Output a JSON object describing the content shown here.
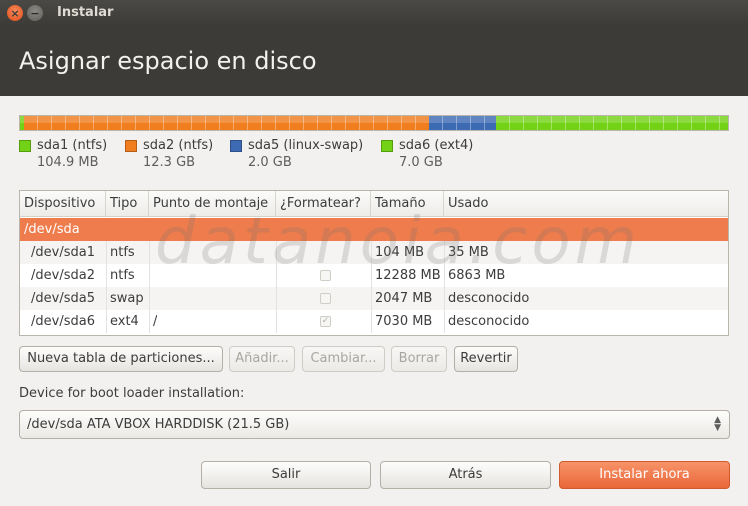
{
  "window": {
    "title": "Instalar",
    "close_glyph": "×",
    "minimize_glyph": "−"
  },
  "page": {
    "title": "Asignar espacio en disco"
  },
  "partition_bar": [
    {
      "name": "sda1",
      "share": 0.005,
      "color": "#73d216"
    },
    {
      "name": "sda2",
      "share": 0.573,
      "color": "#f07d1e"
    },
    {
      "name": "sda5",
      "share": 0.095,
      "color": "#3d6bb3"
    },
    {
      "name": "sda6",
      "share": 0.327,
      "color": "#73d216"
    }
  ],
  "legend": [
    {
      "name": "sda1 (ntfs)",
      "size": "104.9 MB",
      "color": "#73d216"
    },
    {
      "name": "sda2 (ntfs)",
      "size": "12.3 GB",
      "color": "#f07d1e"
    },
    {
      "name": "sda5 (linux-swap)",
      "size": "2.0 GB",
      "color": "#3d6bb3"
    },
    {
      "name": "sda6 (ext4)",
      "size": "7.0 GB",
      "color": "#73d216"
    }
  ],
  "table": {
    "headers": [
      "Dispositivo",
      "Tipo",
      "Punto de montaje",
      "¿Formatear?",
      "Tamaño",
      "Usado"
    ],
    "rows": [
      {
        "device": "/dev/sda",
        "type": "",
        "mount": "",
        "format": null,
        "size": "",
        "used": "",
        "selected": true
      },
      {
        "device": "/dev/sda1",
        "type": "ntfs",
        "mount": "",
        "format": null,
        "size": "104 MB",
        "used": "35 MB",
        "selected": false
      },
      {
        "device": "/dev/sda2",
        "type": "ntfs",
        "mount": "",
        "format": false,
        "size": "12288 MB",
        "used": "6863 MB",
        "selected": false
      },
      {
        "device": "/dev/sda5",
        "type": "swap",
        "mount": "",
        "format": false,
        "size": "2047 MB",
        "used": "desconocido",
        "selected": false
      },
      {
        "device": "/dev/sda6",
        "type": "ext4",
        "mount": "/",
        "format": true,
        "size": "7030 MB",
        "used": "desconocido",
        "selected": false
      }
    ]
  },
  "watermark": "datanoia.com",
  "actions": {
    "new_table": "Nueva tabla de particiones...",
    "add": "Añadir...",
    "change": "Cambiar...",
    "delete": "Borrar",
    "revert": "Revertir"
  },
  "bootloader": {
    "label": "Device for boot loader installation:",
    "value": "/dev/sda ATA VBOX HARDDISK (21.5 GB)"
  },
  "footer": {
    "quit": "Salir",
    "back": "Atrás",
    "install": "Instalar ahora"
  },
  "colors": {
    "accent": "#e9673a",
    "selection": "#ee7c4c",
    "header_bg": "#3c3b37"
  }
}
